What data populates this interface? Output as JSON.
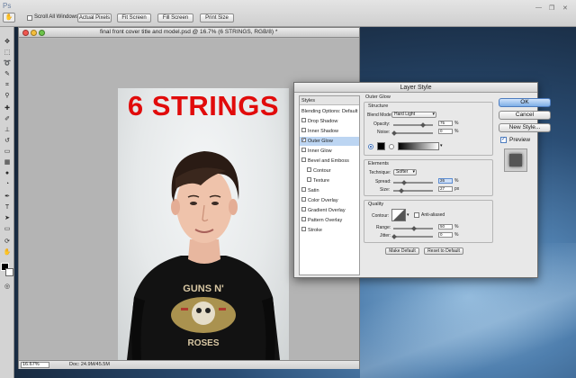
{
  "app": {
    "name": "Ps"
  },
  "options_bar": {
    "scroll_all_label": "Scroll All Windows",
    "buttons": [
      "Actual Pixels",
      "Fit Screen",
      "Fill Screen",
      "Print Size"
    ]
  },
  "document": {
    "title": "final front cover title and model.psd @ 16.7% (6 STRINGS, RGB/8) *",
    "headline": "6 STRINGS",
    "zoom": "16.67%",
    "doc_size": "Doc: 24.9M/45.5M"
  },
  "dialog": {
    "title": "Layer Style",
    "styles_header": "Styles",
    "styles": [
      {
        "label": "Blending Options: Default",
        "checkbox": false,
        "selected": false,
        "indent": false
      },
      {
        "label": "Drop Shadow",
        "checkbox": true,
        "checked": false,
        "selected": false,
        "indent": false
      },
      {
        "label": "Inner Shadow",
        "checkbox": true,
        "checked": false,
        "selected": false,
        "indent": false
      },
      {
        "label": "Outer Glow",
        "checkbox": true,
        "checked": true,
        "selected": true,
        "indent": false
      },
      {
        "label": "Inner Glow",
        "checkbox": true,
        "checked": false,
        "selected": false,
        "indent": false
      },
      {
        "label": "Bevel and Emboss",
        "checkbox": true,
        "checked": false,
        "selected": false,
        "indent": false
      },
      {
        "label": "Contour",
        "checkbox": true,
        "checked": false,
        "selected": false,
        "indent": true
      },
      {
        "label": "Texture",
        "checkbox": true,
        "checked": false,
        "selected": false,
        "indent": true
      },
      {
        "label": "Satin",
        "checkbox": true,
        "checked": false,
        "selected": false,
        "indent": false
      },
      {
        "label": "Color Overlay",
        "checkbox": true,
        "checked": false,
        "selected": false,
        "indent": false
      },
      {
        "label": "Gradient Overlay",
        "checkbox": true,
        "checked": false,
        "selected": false,
        "indent": false
      },
      {
        "label": "Pattern Overlay",
        "checkbox": true,
        "checked": false,
        "selected": false,
        "indent": false
      },
      {
        "label": "Stroke",
        "checkbox": true,
        "checked": false,
        "selected": false,
        "indent": false
      }
    ],
    "outer_glow": {
      "title": "Outer Glow",
      "structure": {
        "title": "Structure",
        "blend_mode_label": "Blend Mode:",
        "blend_mode": "Hard Light",
        "opacity_label": "Opacity:",
        "opacity": "75",
        "noise_label": "Noise:",
        "noise": "0",
        "unit_percent": "%",
        "glow_color": "#000000"
      },
      "elements": {
        "title": "Elements",
        "technique_label": "Technique:",
        "technique": "Softer",
        "spread_label": "Spread:",
        "spread": "26",
        "size_label": "Size:",
        "size": "27",
        "unit_px": "px"
      },
      "quality": {
        "title": "Quality",
        "contour_label": "Contour:",
        "anti_aliased_label": "Anti-aliased",
        "range_label": "Range:",
        "range": "50",
        "jitter_label": "Jitter:",
        "jitter": "0"
      },
      "make_default": "Make Default",
      "reset_default": "Reset to Default"
    },
    "buttons": {
      "ok": "OK",
      "cancel": "Cancel",
      "new_style": "New Style...",
      "preview": "Preview"
    }
  },
  "colors": {
    "headline": "#e10b0b",
    "selection": "#bcd5f2",
    "ok_button": "#7eaee6"
  }
}
